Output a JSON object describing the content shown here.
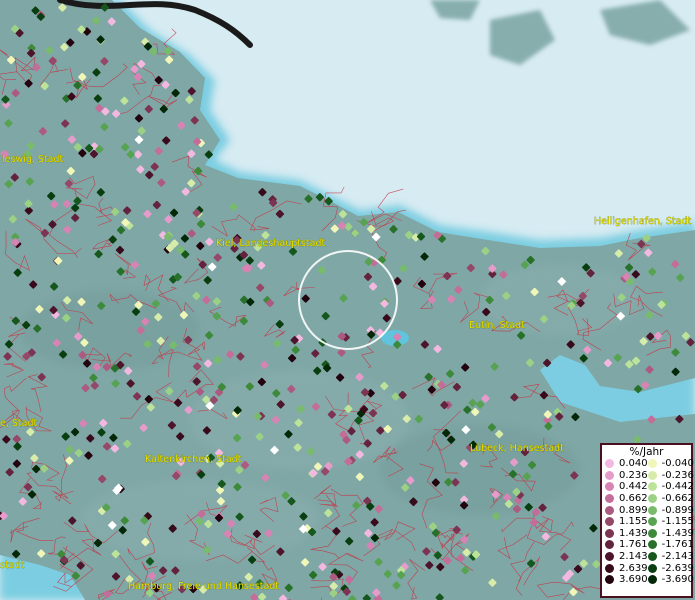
{
  "map": {
    "cities": [
      {
        "name": "Schleswig, Stadt",
        "display": "leswig, Stadt"
      },
      {
        "name": "Kiel, Landeshauptstadt",
        "display": "Kiel, Landeshauptstadt"
      },
      {
        "name": "Heiligenhafen, Stadt",
        "display": "Heiligenhafen, Stadt"
      },
      {
        "name": "Eutin, Stadt",
        "display": "Eutin, Stadt"
      },
      {
        "name": "Lübeck, Hansestadt",
        "display": "Lübeck, Hansestadt"
      },
      {
        "name": "Kaltenkirchen, Stadt",
        "display": "Kaltenkirchen, Stadt"
      },
      {
        "name": "Hamburg, Freie und Hansestadt",
        "display": "Hamburg, Freie und Hansestadt"
      },
      {
        "name": "Heide, Stadt",
        "display": "e, Stadt"
      },
      {
        "name": "Stade",
        "display": "stadt"
      }
    ],
    "colors": {
      "water": "#cfe6ef",
      "land": "#7fa6a4",
      "borders": "#cc2a3a",
      "labels": "#e8e000"
    }
  },
  "legend": {
    "title": "%/Jahr",
    "positive": [
      {
        "label": "0.040",
        "color": "#f2b8e0"
      },
      {
        "label": "0.236",
        "color": "#e69ccb"
      },
      {
        "label": "0.442",
        "color": "#d783b3"
      },
      {
        "label": "0.662",
        "color": "#c46d98"
      },
      {
        "label": "0.899",
        "color": "#ad5a80"
      },
      {
        "label": "1.155",
        "color": "#954868"
      },
      {
        "label": "1.439",
        "color": "#7c3452"
      },
      {
        "label": "1.761",
        "color": "#64233d"
      },
      {
        "label": "2.143",
        "color": "#4d152b"
      },
      {
        "label": "2.639",
        "color": "#380a1b"
      },
      {
        "label": "3.690",
        "color": "#22030e"
      }
    ],
    "negative": [
      {
        "label": "-0.040",
        "color": "#f0f5b8"
      },
      {
        "label": "-0.236",
        "color": "#d8ecaa"
      },
      {
        "label": "-0.442",
        "color": "#bde39a"
      },
      {
        "label": "-0.662",
        "color": "#9bd185"
      },
      {
        "label": "-0.899",
        "color": "#78bb6c"
      },
      {
        "label": "-1.155",
        "color": "#58a352"
      },
      {
        "label": "-1.439",
        "color": "#3d8a3a"
      },
      {
        "label": "-1.761",
        "color": "#27712a"
      },
      {
        "label": "-2.143",
        "color": "#15571c"
      },
      {
        "label": "-2.639",
        "color": "#093f10"
      },
      {
        "label": "-3.690",
        "color": "#032808"
      }
    ]
  }
}
